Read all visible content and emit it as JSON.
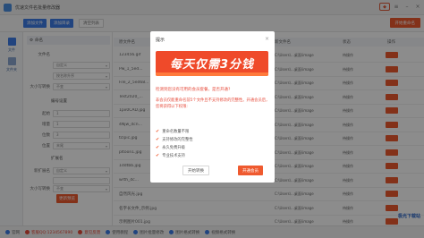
{
  "window": {
    "title": "优速文件名批量修改器"
  },
  "toolbar": {
    "add_file": "添加文件",
    "add_folder": "添加目录",
    "clear": "清空列表",
    "start": "开始重命名"
  },
  "leftrail": [
    {
      "label": "文件"
    },
    {
      "label": "文件夹"
    }
  ],
  "settings": {
    "header": "命名",
    "rows": [
      {
        "label": "文件名",
        "value": ""
      },
      {
        "label": "",
        "value": "自定义"
      },
      {
        "label": "",
        "value": "按名称升序"
      },
      {
        "label": "大小写转换",
        "value": "不变"
      }
    ],
    "number_title": "编号设置",
    "number_rows": [
      {
        "label": "起始",
        "value": "1"
      },
      {
        "label": "增量",
        "value": "1"
      },
      {
        "label": "位数",
        "value": "3"
      },
      {
        "label": "位置",
        "value": "末尾"
      }
    ],
    "ext_title": "扩展名",
    "ext_rows": [
      {
        "label": "新扩展名",
        "value": "自定义"
      },
      {
        "label": "",
        "value": ""
      },
      {
        "label": "大小写转换",
        "value": "不变"
      }
    ],
    "preview_button": "更新预览"
  },
  "table": {
    "headers": {
      "orig": "原文件名",
      "new": "新文件名",
      "status": "状态",
      "op": "操作"
    },
    "rows": [
      {
        "orig": "123456.gif",
        "new": "C:\\Users\\...桌面\\image",
        "status": "待操作"
      },
      {
        "orig": "Pw_1_5ed...",
        "new": "C:\\Users\\...桌面\\image",
        "status": "待操作"
      },
      {
        "orig": "File_2_5ed68...",
        "new": "C:\\Users\\...桌面\\image",
        "status": "待操作"
      },
      {
        "orig": "Test2020_...",
        "new": "C:\\Users\\...桌面\\image",
        "status": "待操作"
      },
      {
        "orig": "1px0CAD.jpg",
        "new": "C:\\Users\\...桌面\\image",
        "status": "待操作"
      },
      {
        "orig": "4Njw_dcn...",
        "new": "C:\\Users\\...桌面\\image",
        "status": "待操作"
      },
      {
        "orig": "tclpic.jpg",
        "new": "C:\\Users\\...桌面\\image",
        "status": "待操作"
      },
      {
        "orig": "pltoon1.jpg",
        "new": "C:\\Users\\...桌面\\image",
        "status": "待操作"
      },
      {
        "orig": "1ddtbb.jpg",
        "new": "C:\\Users\\...桌面\\image",
        "status": "待操作"
      },
      {
        "orig": "wrth_dc...",
        "new": "C:\\Users\\...桌面\\image",
        "status": "待操作"
      },
      {
        "orig": "自然风光.jpg",
        "new": "C:\\Users\\...桌面\\image",
        "status": "待操作"
      },
      {
        "orig": "名字长文件_示例.jpg",
        "new": "C:\\Users\\...桌面\\image",
        "status": "待操作"
      },
      {
        "orig": "示例图片001.jpg",
        "new": "C:\\Users\\...桌面\\image",
        "status": "待操作"
      }
    ]
  },
  "statusbar": [
    {
      "label": "官网",
      "color": "#3d7ce8"
    },
    {
      "label": "客服QQ:1234567890",
      "color": "#e64b3b"
    },
    {
      "label": "意见反馈",
      "color": "#e64b3b"
    },
    {
      "label": "使用教程",
      "color": "#3d7ce8"
    },
    {
      "label": "图片批量修改",
      "color": "#3d7ce8"
    },
    {
      "label": "图片格式转换",
      "color": "#3d7ce8"
    },
    {
      "label": "视频格式转换",
      "color": "#3d7ce8"
    }
  ],
  "watermark": "极光下载站",
  "modal": {
    "title": "提示",
    "close": "×",
    "promo": "每天仅需3分钱",
    "lead": "检测到您没有可用的会员套餐，是否开通?",
    "desc": "非会员仅能重命名前5个文件且不支持修改的完整性。开通会员后，您将获得以下权限:",
    "benefits": [
      "重命名数量不限",
      "支持修改的完整性",
      "永久免费升级",
      "专业技术支持"
    ],
    "btn_continue": "开始转换",
    "btn_vip": "开通会员"
  },
  "colors": {
    "accent": "#ef5a2f",
    "primary": "#3d7ce8"
  }
}
